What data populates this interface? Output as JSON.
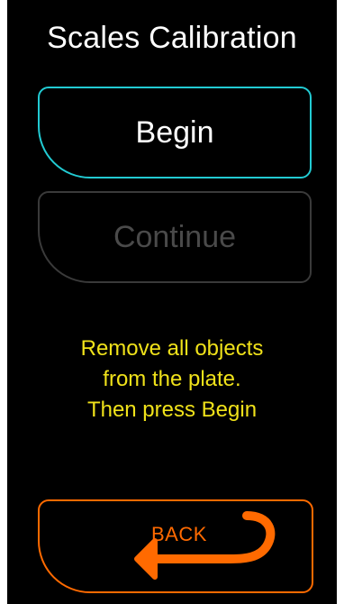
{
  "screen": {
    "title": "Scales Calibration",
    "buttons": {
      "begin": "Begin",
      "continue": "Continue",
      "back": "BACK"
    },
    "message": {
      "lines": [
        "Remove all objects",
        "from the plate.",
        "Then press Begin"
      ]
    },
    "colors": {
      "background": "#000000",
      "title": "#ffffff",
      "begin_border": "#22cbd3",
      "continue_border": "#3a3a3a",
      "continue_text": "#4a4a4a",
      "message": "#f0e21a",
      "back": "#ff6a00"
    },
    "icons": {
      "back": "back-arrow-icon"
    },
    "states": {
      "continue_enabled": false
    }
  }
}
